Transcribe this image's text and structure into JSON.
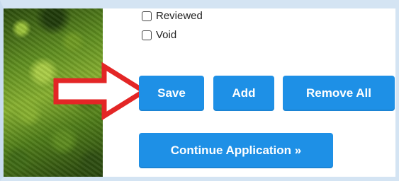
{
  "form": {
    "checkboxes": [
      {
        "label": "Reviewed",
        "checked": false
      },
      {
        "label": "Void",
        "checked": false
      }
    ],
    "buttons": {
      "save": "Save",
      "add": "Add",
      "remove_all": "Remove All",
      "continue": "Continue Application »"
    }
  },
  "annotation": {
    "arrow_color": "#e32626",
    "icon": "right-arrow-icon"
  },
  "colors": {
    "button": "#1e90e6",
    "button_text": "#ffffff"
  }
}
